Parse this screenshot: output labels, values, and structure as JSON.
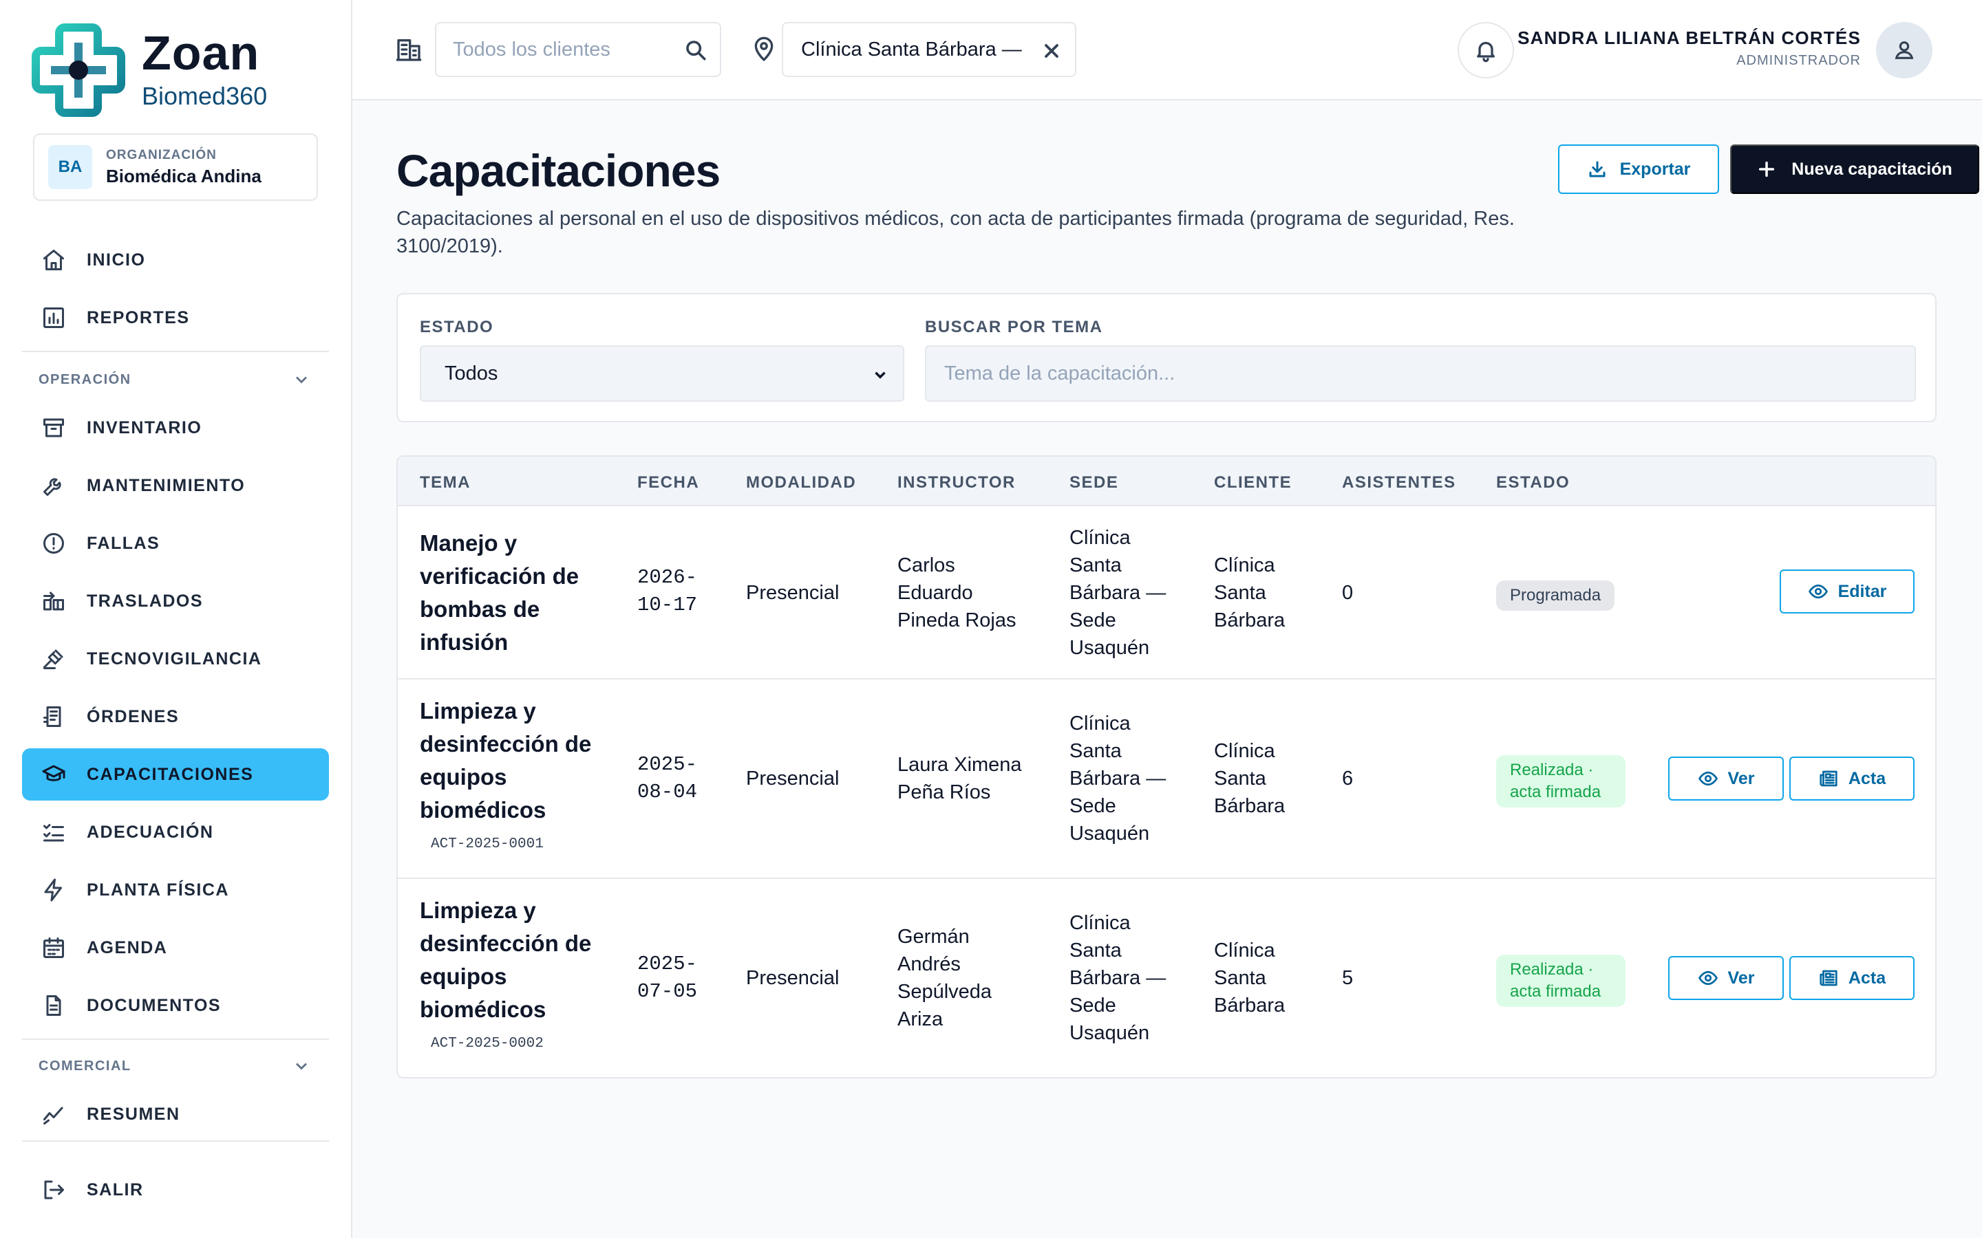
{
  "brand": {
    "name": "Zoan",
    "subtitle": "Biomed360"
  },
  "org": {
    "badge": "BA",
    "label": "ORGANIZACIÓN",
    "name": "Biomédica Andina"
  },
  "nav": {
    "top": [
      {
        "label": "INICIO",
        "icon": "home-icon"
      },
      {
        "label": "REPORTES",
        "icon": "chart-icon"
      }
    ],
    "section_operacion": "OPERACIÓN",
    "operacion": [
      {
        "label": "INVENTARIO",
        "icon": "archive-icon"
      },
      {
        "label": "MANTENIMIENTO",
        "icon": "wrench-icon"
      },
      {
        "label": "FALLAS",
        "icon": "alert-icon"
      },
      {
        "label": "TRASLADOS",
        "icon": "transfer-icon"
      },
      {
        "label": "TECNOVIGILANCIA",
        "icon": "gavel-icon"
      },
      {
        "label": "ÓRDENES",
        "icon": "receipt-icon"
      },
      {
        "label": "CAPACITACIONES",
        "icon": "graduation-icon"
      },
      {
        "label": "ADECUACIÓN",
        "icon": "checklist-icon"
      },
      {
        "label": "PLANTA FÍSICA",
        "icon": "bolt-icon"
      },
      {
        "label": "AGENDA",
        "icon": "calendar-icon"
      },
      {
        "label": "DOCUMENTOS",
        "icon": "document-icon"
      }
    ],
    "section_comercial": "COMERCIAL",
    "comercial": [
      {
        "label": "RESUMEN",
        "icon": "trend-icon"
      }
    ],
    "logout": "SALIR"
  },
  "topbar": {
    "client_placeholder": "Todos los clientes",
    "site_value": "Clínica Santa Bárbara —",
    "user_name": "SANDRA LILIANA BELTRÁN CORTÉS",
    "user_role": "ADMINISTRADOR"
  },
  "page": {
    "title": "Capacitaciones",
    "description": "Capacitaciones al personal en el uso de dispositivos médicos, con acta de participantes firmada (programa de seguridad, Res. 3100/2019).",
    "export_label": "Exportar",
    "new_label": "Nueva capacitación"
  },
  "filters": {
    "estado_label": "ESTADO",
    "estado_value": "Todos",
    "search_label": "BUSCAR POR TEMA",
    "search_placeholder": "Tema de la capacitación..."
  },
  "table": {
    "headers": [
      "TEMA",
      "FECHA",
      "MODALIDAD",
      "INSTRUCTOR",
      "SEDE",
      "CLIENTE",
      "ASISTENTES",
      "ESTADO"
    ],
    "rows": [
      {
        "topic": "Manejo y verificación de bombas de infusión",
        "code": "",
        "date": "2026-10-17",
        "modality": "Presencial",
        "instructor": "Carlos Eduardo Pineda Rojas",
        "site": "Clínica Santa Bárbara — Sede Usaquén",
        "client": "Clínica Santa Bárbara",
        "attendees": "0",
        "status": "Programada",
        "actions": [
          "Editar"
        ]
      },
      {
        "topic": "Limpieza y desinfección de equipos biomédicos",
        "code": "ACT-2025-0001",
        "date": "2025-08-04",
        "modality": "Presencial",
        "instructor": "Laura Ximena Peña Ríos",
        "site": "Clínica Santa Bárbara — Sede Usaquén",
        "client": "Clínica Santa Bárbara",
        "attendees": "6",
        "status": "Realizada · acta firmada",
        "actions": [
          "Ver",
          "Acta"
        ]
      },
      {
        "topic": "Limpieza y desinfección de equipos biomédicos",
        "code": "ACT-2025-0002",
        "date": "2025-07-05",
        "modality": "Presencial",
        "instructor": "Germán Andrés Sepúlveda Ariza",
        "site": "Clínica Santa Bárbara — Sede Usaquén",
        "client": "Clínica Santa Bárbara",
        "attendees": "5",
        "status": "Realizada · acta firmada",
        "actions": [
          "Ver",
          "Acta"
        ]
      }
    ]
  },
  "colors": {
    "accent": "#38bdf8",
    "primary_dark": "#0b1324",
    "link": "#0369a1",
    "success": "#16a34a"
  }
}
